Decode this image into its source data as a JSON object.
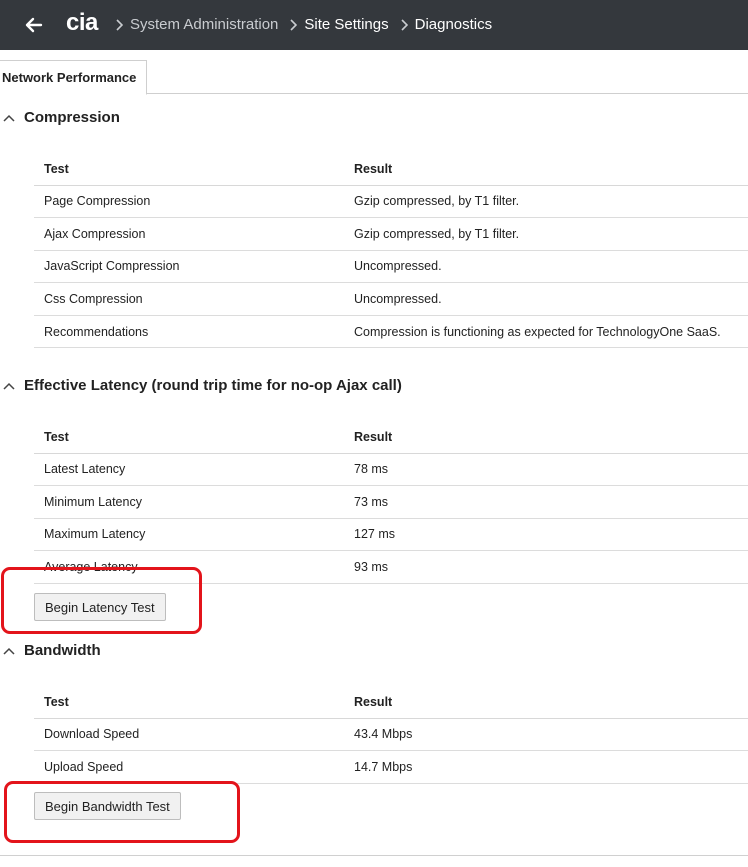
{
  "header": {
    "logo": "cia",
    "breadcrumbs": [
      "System Administration",
      "Site Settings",
      "Diagnostics"
    ]
  },
  "tabs": [
    {
      "label": "Network Performance"
    }
  ],
  "compression": {
    "title": "Compression",
    "col_test": "Test",
    "col_result": "Result",
    "rows": [
      {
        "test": "Page Compression",
        "result": "Gzip compressed, by T1 filter."
      },
      {
        "test": "Ajax Compression",
        "result": "Gzip compressed, by T1 filter."
      },
      {
        "test": "JavaScript Compression",
        "result": "Uncompressed."
      },
      {
        "test": "Css Compression",
        "result": "Uncompressed."
      },
      {
        "test": "Recommendations",
        "result": "Compression is functioning as expected for TechnologyOne SaaS."
      }
    ]
  },
  "latency": {
    "title": "Effective Latency (round trip time for no-op Ajax call)",
    "col_test": "Test",
    "col_result": "Result",
    "rows": [
      {
        "test": "Latest Latency",
        "result": "78 ms"
      },
      {
        "test": "Minimum Latency",
        "result": "73 ms"
      },
      {
        "test": "Maximum Latency",
        "result": "127 ms"
      },
      {
        "test": "Average Latency",
        "result": "93 ms"
      }
    ],
    "button": "Begin Latency Test"
  },
  "bandwidth": {
    "title": "Bandwidth",
    "col_test": "Test",
    "col_result": "Result",
    "rows": [
      {
        "test": "Download Speed",
        "result": "43.4 Mbps"
      },
      {
        "test": "Upload Speed",
        "result": "14.7 Mbps"
      }
    ],
    "button": "Begin Bandwidth Test"
  },
  "colors": {
    "topbar": "#34383d",
    "highlight": "#e3141b"
  }
}
